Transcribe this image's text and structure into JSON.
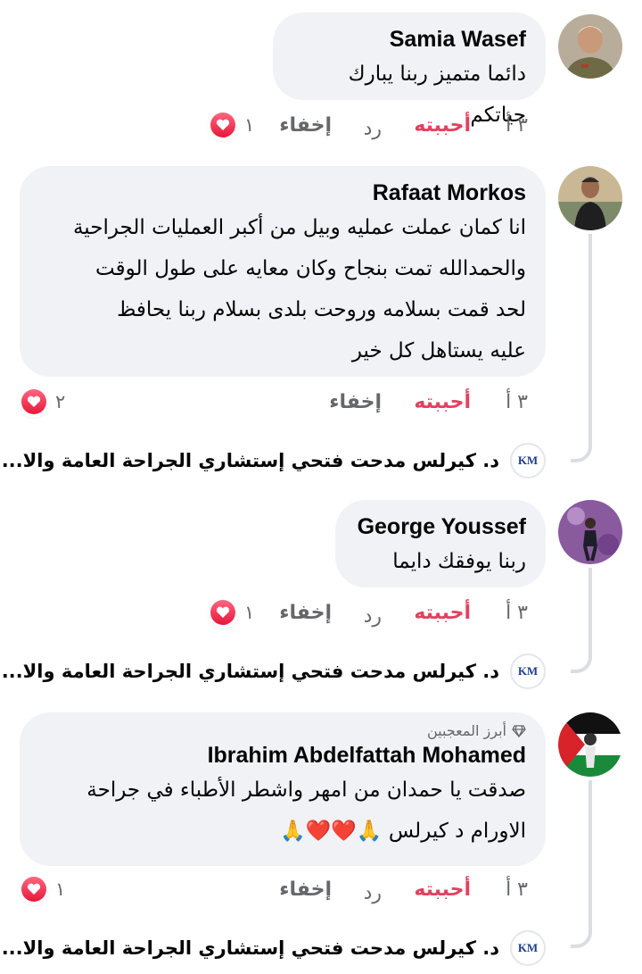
{
  "comments": [
    {
      "author": "Samia Wasef",
      "lines": [
        "دائما متميز ربنا يبارك حياتكم"
      ],
      "time": "٣ أ",
      "like_label": "أحببته",
      "reply_label": "رد",
      "hide_label": "إخفاء",
      "reaction_count": "١"
    },
    {
      "author": "Rafaat Morkos",
      "lines": [
        "انا كمان عملت عمليه وبيل من أكبر العمليات الجراحية",
        "والحمدالله تمت بنجاح وكان معايه على طول الوقت",
        "لحد قمت بسلامه وروحت بلدى بسلام ربنا يحافظ",
        "عليه يستاهل كل خير"
      ],
      "time": "٣ أ",
      "like_label": "أحببته",
      "hide_label": "إخفاء",
      "reaction_count": "٢",
      "reply_preview": "د. كيرلس مدحت فتحي إستشاري الجراحة العامة والا... ..."
    },
    {
      "author": "George Youssef",
      "lines": [
        "ربنا يوفقك دايما"
      ],
      "time": "٣ أ",
      "like_label": "أحببته",
      "reply_label": "رد",
      "hide_label": "إخفاء",
      "reaction_count": "١",
      "reply_preview": "د. كيرلس مدحت فتحي إستشاري الجراحة العامة والا... ..."
    },
    {
      "badge": "أبرز المعجبين",
      "author": "Ibrahim Abdelfattah Mohamed",
      "lines": [
        "صدقت يا حمدان من امهر واشطر الأطباء في جراحة",
        "الاورام د كيرلس 🙏❤️❤️🙏"
      ],
      "time": "٣ أ",
      "like_label": "أحببته",
      "reply_label": "رد",
      "hide_label": "إخفاء",
      "reaction_count": "١",
      "reply_preview": "د. كيرلس مدحت فتحي إستشاري الجراحة العامة والا... ..."
    }
  ],
  "km_logo_text": "KM",
  "colors": {
    "liked": "#e4405f",
    "bubble": "#f0f2f5",
    "muted": "#65676b"
  }
}
